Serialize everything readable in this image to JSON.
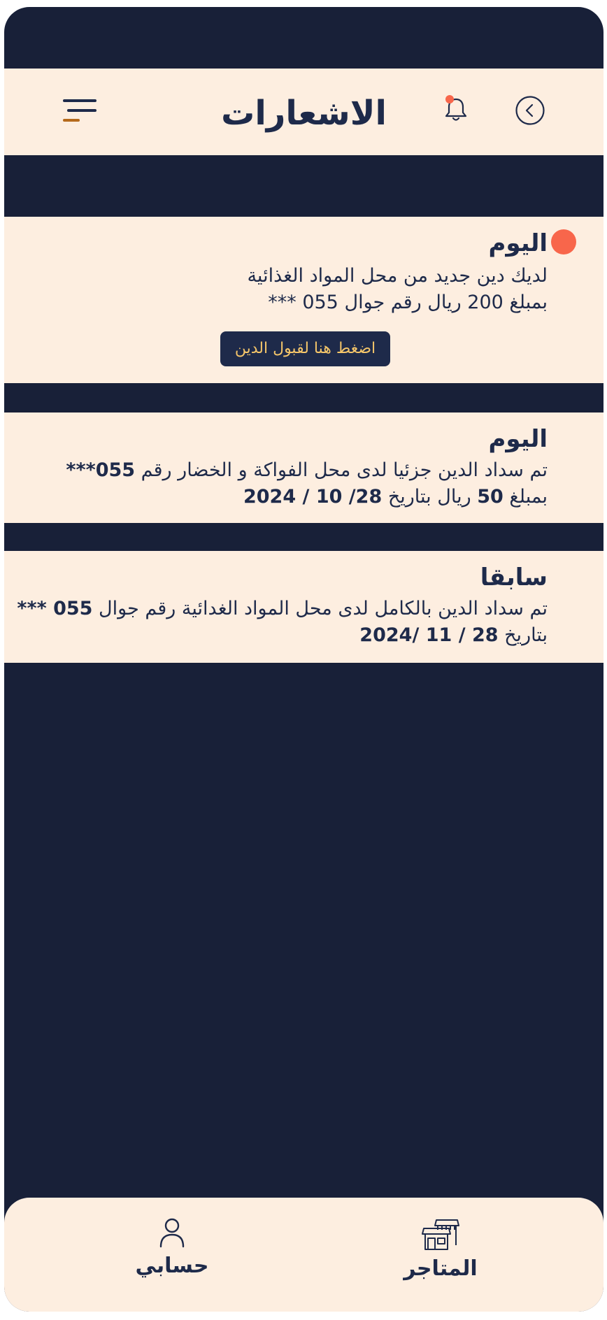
{
  "header": {
    "title": "الاشعارات",
    "menu_icon": "hamburger-menu-icon",
    "bell_icon": "notification-bell-icon",
    "back_icon": "chevron-left-circle-icon"
  },
  "colors": {
    "navy": "#182038",
    "cream": "#fdeee0",
    "text": "#1e2a4a",
    "accent_orange": "#f8664b",
    "button_text": "#f5c66a",
    "menu_accent": "#b56a1c"
  },
  "notifications": [
    {
      "heading": "اليوم",
      "unread": true,
      "line1": "لديك دين جديد من محل المواد الغذائية",
      "line2": "بمبلغ 200 ريال رقم جوال 055 ***",
      "button_label": "اضغط هنا لقبول الدين"
    },
    {
      "heading": "اليوم",
      "line1_a": "تم سداد الدين جزئيا لدى محل الفواكة و الخضار رقم ",
      "line1_b": "055***",
      "line2_a": "بمبلغ ",
      "line2_b": "50",
      "line2_c": " ريال بتاريخ ",
      "line2_d": "28/ 10 / 2024"
    },
    {
      "heading": "سابقا",
      "line1_a": "تم سداد الدين بالكامل لدى محل المواد الغدائية رقم جوال ",
      "line1_b": "055 ***",
      "line2_a": "بتاريخ ",
      "line2_b": "28 / 11 /2024"
    }
  ],
  "bottom_nav": {
    "account_label": "حسابي",
    "account_icon": "user-icon",
    "stores_label": "المتاجر",
    "stores_icon": "store-icon"
  }
}
